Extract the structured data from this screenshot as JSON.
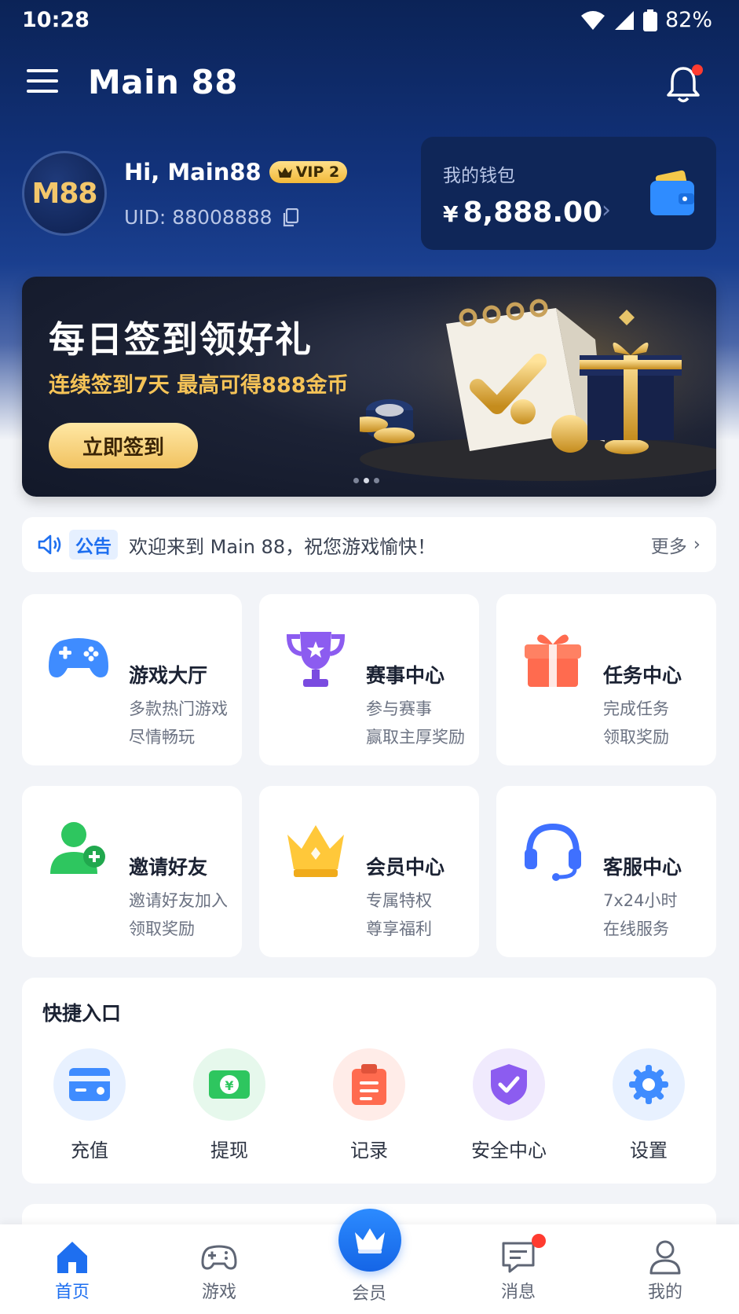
{
  "status_bar": {
    "time": "10:28",
    "battery": "82%"
  },
  "header": {
    "title": "Main 88"
  },
  "profile": {
    "avatar_text": "M88",
    "greeting": "Hi, Main88",
    "vip": "VIP 2",
    "uid": "UID: 88008888"
  },
  "wallet": {
    "label": "我的钱包",
    "currency": "¥",
    "amount": "8,888.00"
  },
  "banner": {
    "title": "每日签到领好礼",
    "subtitle": "连续签到7天 最高可得888金币",
    "button": "立即签到"
  },
  "notice": {
    "tag": "公告",
    "text": "欢迎来到 Main 88，祝您游戏愉快！",
    "more": "更多"
  },
  "features": [
    {
      "title": "游戏大厅",
      "line1": "多款热门游戏",
      "line2": "尽情畅玩",
      "icon": "gamepad-icon"
    },
    {
      "title": "赛事中心",
      "line1": "参与赛事",
      "line2": "赢取主厚奖励",
      "icon": "trophy-icon"
    },
    {
      "title": "任务中心",
      "line1": "完成任务",
      "line2": "领取奖励",
      "icon": "gift-icon"
    },
    {
      "title": "邀请好友",
      "line1": "邀请好友加入",
      "line2": "领取奖励",
      "icon": "user-invite-icon"
    },
    {
      "title": "会员中心",
      "line1": "专属特权",
      "line2": "尊享福利",
      "icon": "crown-icon"
    },
    {
      "title": "客服中心",
      "line1": "7x24小时",
      "line2": "在线服务",
      "icon": "headset-icon"
    }
  ],
  "quick": {
    "title": "快捷入口",
    "items": [
      {
        "label": "充值",
        "icon": "card-icon"
      },
      {
        "label": "提现",
        "icon": "cash-icon"
      },
      {
        "label": "记录",
        "icon": "clipboard-icon"
      },
      {
        "label": "安全中心",
        "icon": "shield-icon"
      },
      {
        "label": "设置",
        "icon": "gear-icon"
      }
    ]
  },
  "tabs": [
    {
      "label": "首页",
      "icon": "home-icon"
    },
    {
      "label": "游戏",
      "icon": "gamepad-outline-icon"
    },
    {
      "label": "会员",
      "icon": "crown-icon"
    },
    {
      "label": "消息",
      "icon": "message-icon"
    },
    {
      "label": "我的",
      "icon": "person-icon"
    }
  ],
  "colors": {
    "primary": "#1e6ff0",
    "gold": "#f5c357",
    "navy": "#0b2357"
  }
}
